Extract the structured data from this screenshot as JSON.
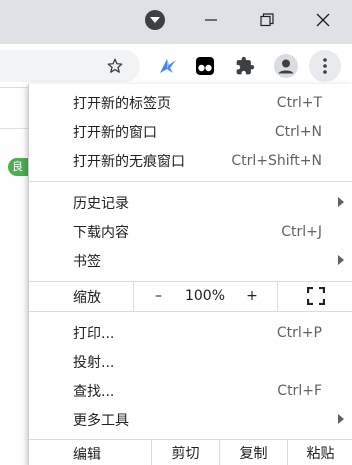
{
  "menu": {
    "section1": [
      {
        "label": "打开新的标签页",
        "shortcut": "Ctrl+T"
      },
      {
        "label": "打开新的窗口",
        "shortcut": "Ctrl+N"
      },
      {
        "label": "打开新的无痕窗口",
        "shortcut": "Ctrl+Shift+N"
      }
    ],
    "section2": [
      {
        "label": "历史记录",
        "shortcut": ""
      },
      {
        "label": "下载内容",
        "shortcut": "Ctrl+J"
      },
      {
        "label": "书签",
        "shortcut": ""
      }
    ],
    "zoom": {
      "label": "缩放",
      "minus": "–",
      "value": "100%",
      "plus": "+"
    },
    "section3": [
      {
        "label": "打印...",
        "shortcut": "Ctrl+P"
      },
      {
        "label": "投射...",
        "shortcut": ""
      },
      {
        "label": "查找...",
        "shortcut": "Ctrl+F"
      },
      {
        "label": "更多工具",
        "shortcut": ""
      }
    ],
    "edit": {
      "label": "编辑",
      "cut": "剪切",
      "copy": "复制",
      "paste": "粘贴"
    }
  },
  "page": {
    "badge": "良"
  },
  "colors": {
    "titlebar": "#dee1e6",
    "accent_ext": "#4285f4",
    "badge": "#4caf50"
  },
  "icons": [
    "dropdown-icon",
    "minimize-icon",
    "maximize-icon",
    "close-icon",
    "star-icon",
    "extension-bird-icon",
    "extension-tampermonkey-icon",
    "puzzle-icon",
    "profile-icon",
    "more-vert-icon",
    "fullscreen-icon"
  ]
}
